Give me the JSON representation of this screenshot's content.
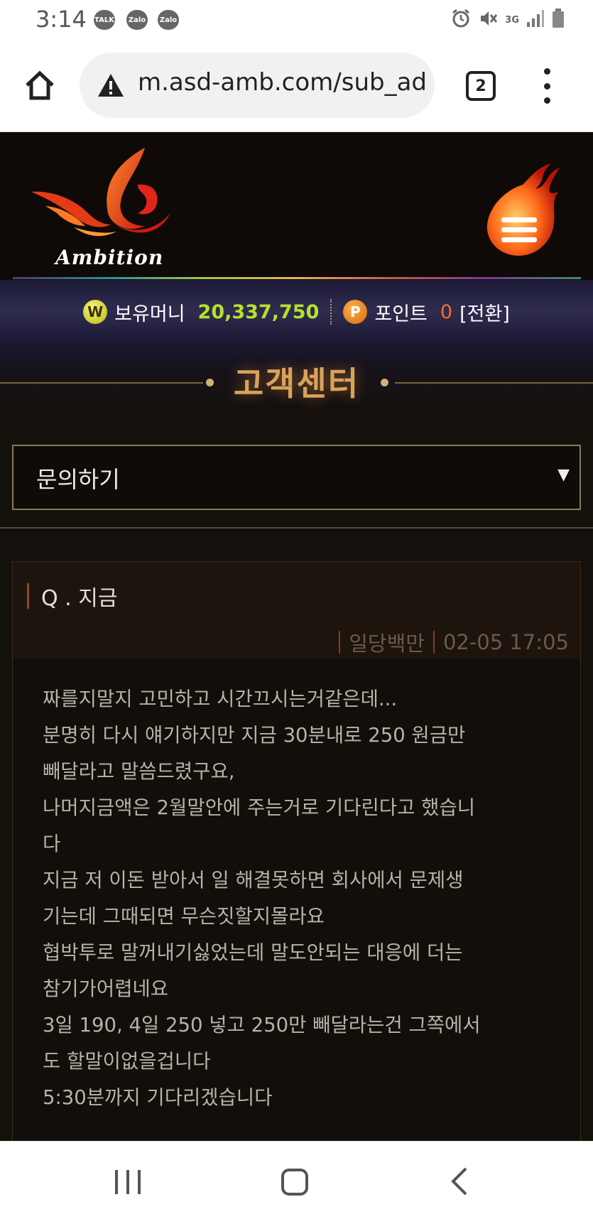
{
  "status_bar": {
    "time": "3:14",
    "notifications": [
      "TALK",
      "Zalo",
      "Zalo"
    ],
    "network": "3G",
    "icons": [
      "alarm-icon",
      "mute-icon",
      "signal-icon",
      "battery-icon"
    ]
  },
  "browser": {
    "url": "m.asd-amb.com/sub_ad",
    "tab_count": "2",
    "icons": [
      "home-icon",
      "warning-icon",
      "more-vert-icon"
    ]
  },
  "site": {
    "logo_text": "Ambition",
    "money": {
      "coin_w": "W",
      "label": "보유머니",
      "value": "20,337,750"
    },
    "points": {
      "coin_p": "P",
      "label": "포인트",
      "value": "0",
      "convert": "[전환]"
    },
    "page_title": "고객센터",
    "select": {
      "value": "문의하기",
      "arrow": "▼"
    },
    "qa": {
      "title": "Q . 지금",
      "author": "일당백만",
      "datetime": "02-05 17:05",
      "lines": [
        "짜를지말지 고민하고 시간끄시는거같은데...",
        "분명히 다시 얘기하지만 지금 30분내로 250 원금만",
        "빼달라고 말씀드렸구요,",
        "나머지금액은 2월말안에 주는거로 기다린다고 했습니",
        "다",
        "지금 저 이돈 받아서 일 해결못하면 회사에서 문제생",
        "기는데 그때되면 무슨짓할지몰라요",
        "협박투로 말꺼내기싫었는데 말도안되는 대응에 더는",
        "참기가어렵네요",
        "3일 190, 4일 250 넣고 250만 빼달라는건 그쪽에서",
        "도 할말이없을겁니다",
        "5:30분까지 기다리겠습니다"
      ]
    },
    "colors": {
      "money": "#b6e12c",
      "points": "#ff6a2c",
      "title": "#d9a25d"
    }
  }
}
